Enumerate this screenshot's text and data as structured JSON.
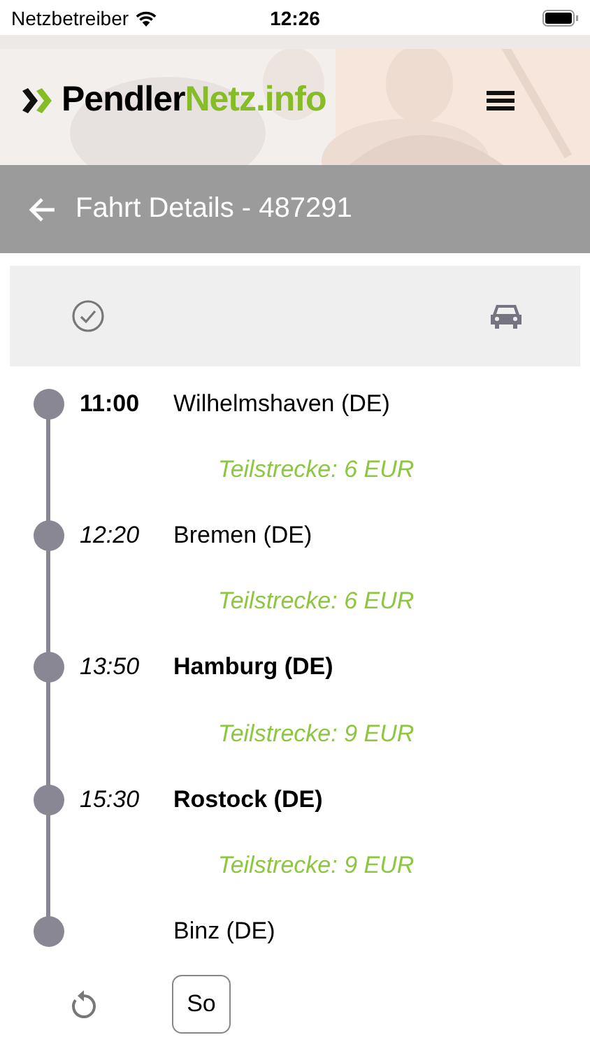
{
  "status_bar": {
    "carrier": "Netzbetreiber",
    "time": "12:26"
  },
  "header": {
    "logo": {
      "first": "Pendler",
      "second": "Netz.info"
    }
  },
  "title_bar": {
    "title": "Fahrt Details - 487291"
  },
  "route": [
    {
      "kind": "stop",
      "time": "11:00",
      "time_bold": true,
      "place": "Wilhelmshaven (DE)",
      "highlighted": false
    },
    {
      "kind": "segment",
      "text": "Teilstrecke: 6 EUR"
    },
    {
      "kind": "stop",
      "time": "12:20",
      "time_bold": false,
      "place": "Bremen (DE)",
      "highlighted": false
    },
    {
      "kind": "segment",
      "text": "Teilstrecke: 6 EUR"
    },
    {
      "kind": "stop",
      "time": "13:50",
      "time_bold": false,
      "place": "Hamburg (DE)",
      "highlighted": true
    },
    {
      "kind": "segment",
      "text": "Teilstrecke: 9 EUR"
    },
    {
      "kind": "stop",
      "time": "15:30",
      "time_bold": false,
      "place": "Rostock (DE)",
      "highlighted": true
    },
    {
      "kind": "segment",
      "text": "Teilstrecke: 9 EUR"
    },
    {
      "kind": "stop",
      "place": "Binz (DE)",
      "highlighted": false
    }
  ],
  "footer": {
    "day_button": "So"
  }
}
